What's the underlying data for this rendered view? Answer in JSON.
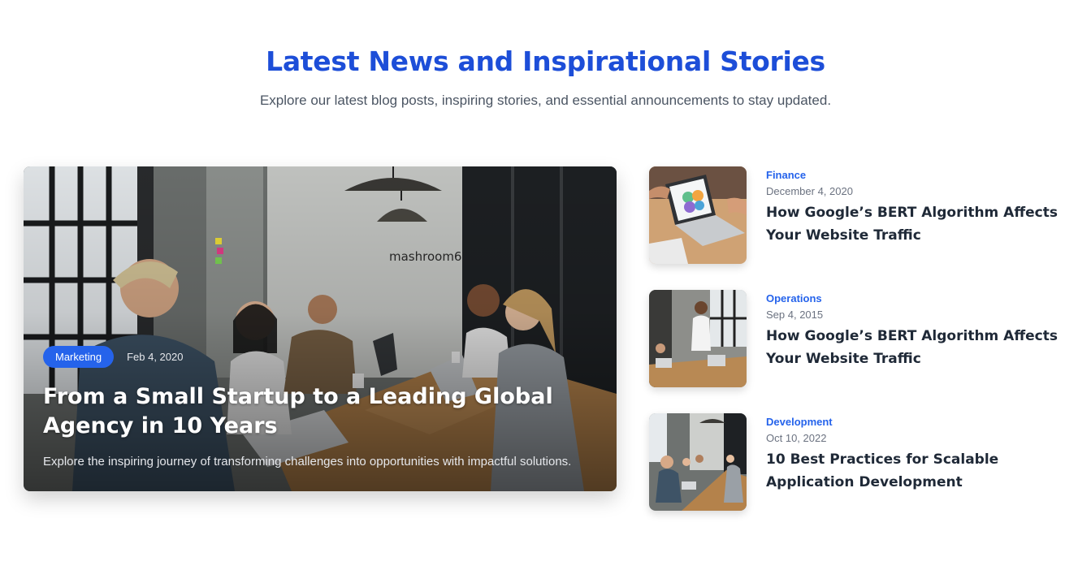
{
  "header": {
    "title": "Latest News and Inspirational Stories",
    "subtitle": "Explore our latest blog posts, inspiring stories, and essential announcements to stay updated."
  },
  "featured": {
    "category": "Marketing",
    "date": "Feb 4, 2020",
    "title": "From a Small Startup to a Leading Global Agency in 10 Years",
    "excerpt": "Explore the inspiring journey of transforming challenges into opportunities with impactful solutions.",
    "wall_sign": "mashroom6"
  },
  "posts": [
    {
      "category": "Finance",
      "date": "December 4, 2020",
      "title": "How Google’s BERT Algorithm Affects Your Website Traffic"
    },
    {
      "category": "Operations",
      "date": "Sep 4, 2015",
      "title": "How Google’s BERT Algorithm Affects Your Website Traffic"
    },
    {
      "category": "Development",
      "date": "Oct 10, 2022",
      "title": "10 Best Practices for Scalable Application Development"
    }
  ],
  "colors": {
    "accent": "#1d4ed8",
    "badge": "#2563eb",
    "text": "#1f2937",
    "muted": "#6b7280"
  }
}
